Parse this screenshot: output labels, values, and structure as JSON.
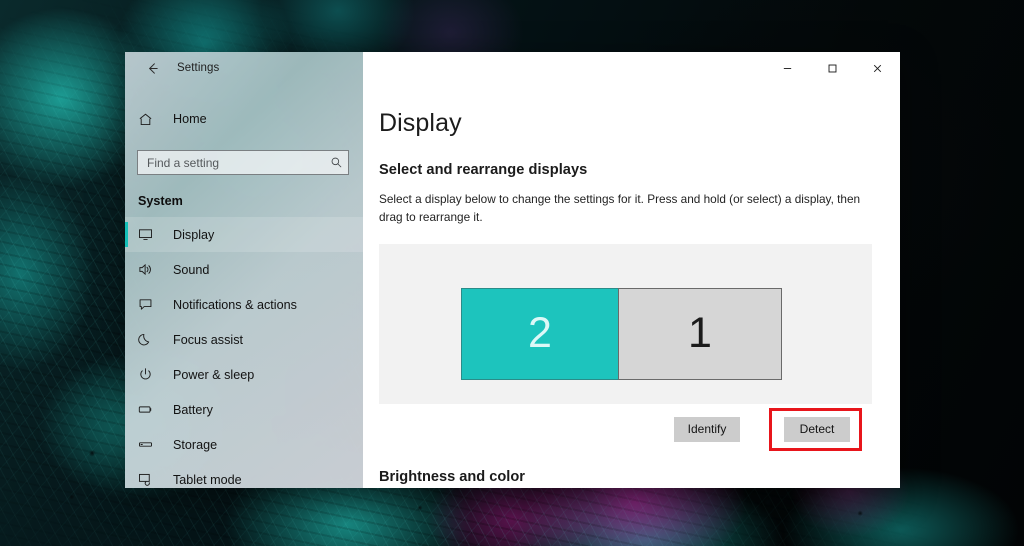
{
  "window": {
    "title": "Settings",
    "back_icon": "back-arrow-icon",
    "caption": {
      "minimize": "minimize-icon",
      "maximize": "maximize-icon",
      "close": "close-icon"
    }
  },
  "sidebar": {
    "home": {
      "label": "Home",
      "icon": "home-icon"
    },
    "search": {
      "placeholder": "Find a setting",
      "value": "",
      "icon": "search-icon"
    },
    "category": "System",
    "items": [
      {
        "label": "Display",
        "icon": "monitor-icon",
        "selected": true
      },
      {
        "label": "Sound",
        "icon": "speaker-icon",
        "selected": false
      },
      {
        "label": "Notifications & actions",
        "icon": "notification-icon",
        "selected": false
      },
      {
        "label": "Focus assist",
        "icon": "moon-icon",
        "selected": false
      },
      {
        "label": "Power & sleep",
        "icon": "power-icon",
        "selected": false
      },
      {
        "label": "Battery",
        "icon": "battery-icon",
        "selected": false
      },
      {
        "label": "Storage",
        "icon": "storage-icon",
        "selected": false
      },
      {
        "label": "Tablet mode",
        "icon": "tablet-icon",
        "selected": false
      }
    ]
  },
  "main": {
    "page_title": "Display",
    "section_heading": "Select and rearrange displays",
    "section_description": "Select a display below to change the settings for it. Press and hold (or select) a display, then drag to rearrange it.",
    "displays": [
      {
        "number": "2",
        "selected": true
      },
      {
        "number": "1",
        "selected": false
      }
    ],
    "identify_label": "Identify",
    "detect_label": "Detect",
    "subsection_heading": "Brightness and color"
  },
  "annotation": {
    "target": "detect-button",
    "color": "#e8151b"
  },
  "colors": {
    "accent_teal": "#1dc4bd",
    "selected_display": "#1dc4bd",
    "unselected_display": "#d6d6d6",
    "canvas_background": "#f2f2f2",
    "button_face": "#cccccc",
    "highlight_red": "#e8151b"
  }
}
